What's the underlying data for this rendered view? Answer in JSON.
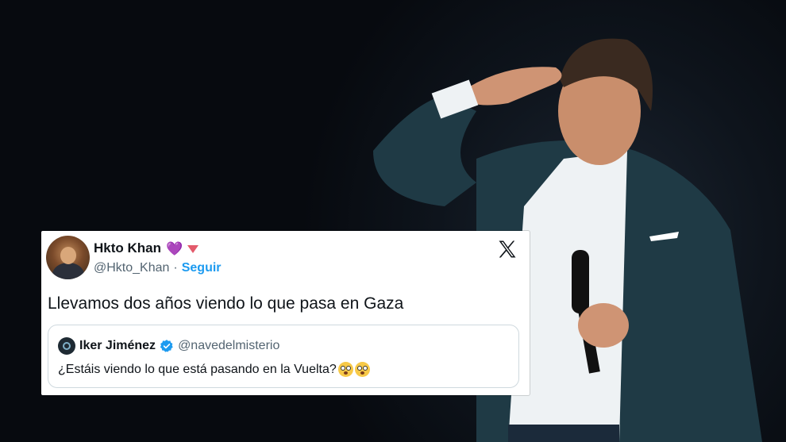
{
  "tweet": {
    "display_name": "Hkto Khan",
    "handle": "@Hkto_Khan",
    "separator": "·",
    "follow_label": "Seguir",
    "text": "Llevamos dos años viendo lo que pasa en Gaza",
    "name_emoji_heart": "💜",
    "platform_icon": "x-logo-icon"
  },
  "quote": {
    "display_name": "Iker Jiménez",
    "handle": "@navedelmisterio",
    "text": "¿Estáis viendo lo que está pasando en la Vuelta?",
    "verified_color": "#1d9bf0",
    "emojis": [
      "flushed-face-emoji",
      "flushed-face-emoji"
    ]
  },
  "colors": {
    "accent": "#1d9bf0",
    "text_primary": "#0f1419",
    "text_secondary": "#536471"
  }
}
